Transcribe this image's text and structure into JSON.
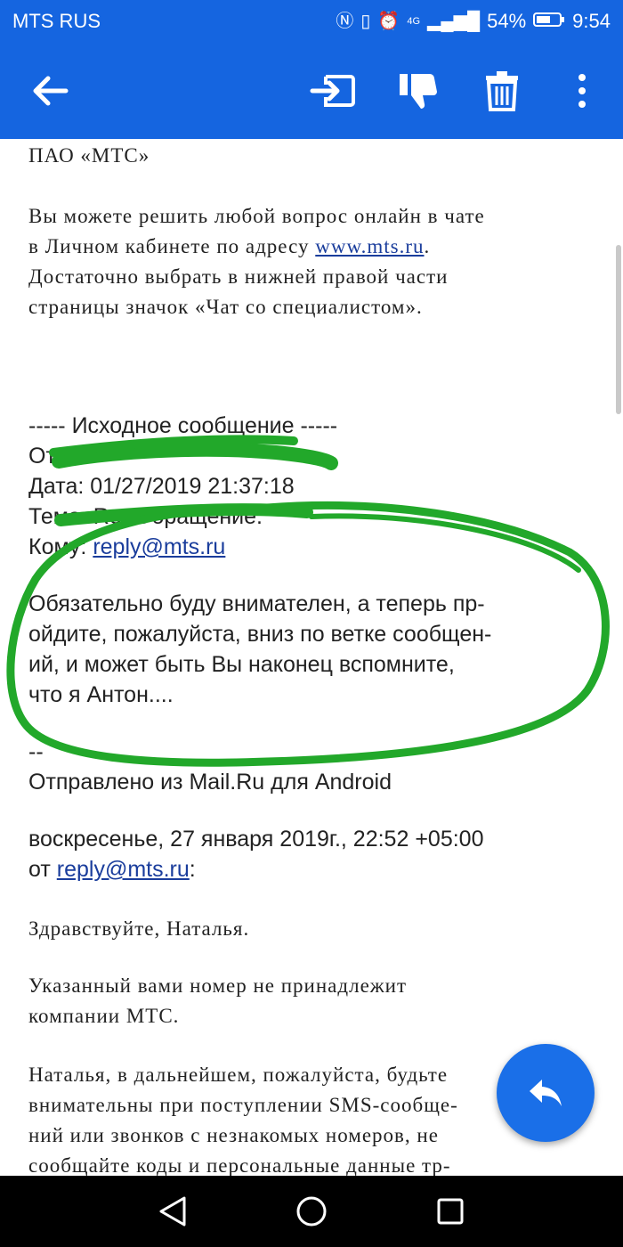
{
  "status_bar": {
    "carrier": "MTS RUS",
    "battery": "54%",
    "time": "9:54",
    "network": "4G"
  },
  "toolbar": {
    "back_icon": "arrow-left-icon",
    "move_icon": "move-to-folder-icon",
    "spam_icon": "thumbs-down-icon",
    "delete_icon": "trash-icon",
    "more_icon": "more-vert-icon"
  },
  "email": {
    "sender_org": "ПАО «МТС»",
    "help_lines": [
      "Вы можете решить любой вопрос онлайн в чате",
      "в Личном кабинете по адресу ",
      "Достаточно выбрать в нижней правой части",
      "страницы значок «Чат со специалистом»."
    ],
    "help_link": "www.mts.ru",
    "help_link_suffix": ".",
    "original_header": "----- Исходное сообщение -----",
    "from_label": "От",
    "date_line": "Дата: 01/27/2019 21:37:18",
    "subject_line": "Тема: Re: Обращение.",
    "to_label": "Кому: ",
    "to_email": "reply@mts.ru",
    "message_lines": [
      "Обязательно буду внимателен, а теперь пр-",
      "ойдите, пожалуйста, вниз по ветке сообщен-",
      "ий, и может быть Вы наконец вспомните,",
      "что я Антон...."
    ],
    "signature_sep": "--",
    "signature": "Отправлено из Mail.Ru для Android",
    "quote_date": "воскресенье, 27 января 2019г., 22:52 +05:00",
    "quote_from_label": "от ",
    "quote_from_email": "reply@mts.ru",
    "quote_from_suffix": ":",
    "greeting": "Здравствуйте, Наталья.",
    "para1_lines": [
      "Указанный вами номер не принадлежит",
      "компании МТС."
    ],
    "para2_lines": [
      "Наталья, в дальнейшем, пожалуйста, будьте",
      "внимательны при поступлении SMS-сообще-",
      "ний или звонков с незнакомых номеров, не",
      "сообщайте коды и персональные данные тр-"
    ]
  },
  "fab": {
    "icon": "reply-icon"
  },
  "nav": {
    "back_icon": "nav-back-icon",
    "home_icon": "nav-home-icon",
    "recents_icon": "nav-recents-icon"
  },
  "colors": {
    "primary": "#1565e0",
    "fab": "#1a6fe8",
    "link": "#1a3d9c",
    "marker": "#22a82a"
  }
}
